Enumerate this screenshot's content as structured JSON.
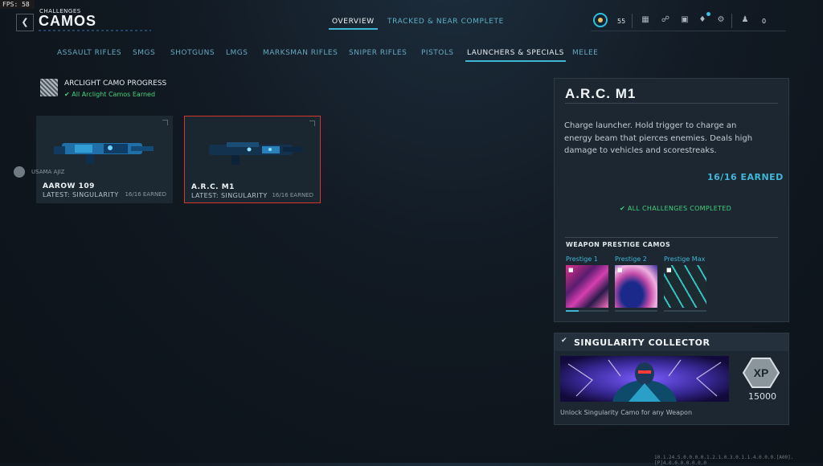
{
  "fps": {
    "label": "FPS:",
    "value": "58"
  },
  "header": {
    "breadcrumb": "CHALLENGES",
    "title": "CAMOS",
    "back_icon": "chevron-left-icon",
    "tabs": [
      {
        "label": "OVERVIEW",
        "active": true
      },
      {
        "label": "TRACKED & NEAR COMPLETE",
        "active": false
      }
    ],
    "level": "55",
    "players": "0"
  },
  "categories": [
    {
      "label": "ASSAULT RIFLES",
      "active": false
    },
    {
      "label": "SMGS",
      "active": false
    },
    {
      "label": "SHOTGUNS",
      "active": false
    },
    {
      "label": "LMGS",
      "active": false
    },
    {
      "label": "MARKSMAN RIFLES",
      "active": false
    },
    {
      "label": "SNIPER RIFLES",
      "active": false
    },
    {
      "label": "PISTOLS",
      "active": false
    },
    {
      "label": "LAUNCHERS & SPECIALS",
      "active": true
    },
    {
      "label": "MELEE",
      "active": false
    }
  ],
  "arclight": {
    "title": "ARCLIGHT CAMO PROGRESS",
    "status": "All Arclight Camos Earned"
  },
  "user_tag": {
    "name": "USAMA AJIZ"
  },
  "weapons": [
    {
      "name": "AAROW 109",
      "subtitle": "LATEST: SINGULARITY",
      "count": "16/16 EARNED",
      "selected": false
    },
    {
      "name": "A.R.C. M1",
      "subtitle": "LATEST: SINGULARITY",
      "count": "16/16 EARNED",
      "selected": true
    }
  ],
  "detail": {
    "title": "A.R.C. M1",
    "description": "Charge launcher. Hold trigger to charge an energy beam that pierces enemies. Deals high damage to vehicles and scorestreaks.",
    "earned": "16/16 EARNED",
    "complete": "ALL CHALLENGES COMPLETED",
    "prestige_heading": "WEAPON PRESTIGE CAMOS",
    "prestige": [
      {
        "label": "Prestige 1"
      },
      {
        "label": "Prestige 2"
      },
      {
        "label": "Prestige Max"
      }
    ]
  },
  "collector": {
    "title": "SINGULARITY COLLECTOR",
    "xp_label": "XP",
    "xp_value": "15000",
    "description": "Unlock Singularity Camo for any Weapon"
  },
  "footer": "10.1.24.5.0.0.0.0.1.2.1.0.3.0.1.1.4.0.0.0.[A00].[P]4.0.0.0.0.0.0.0"
}
